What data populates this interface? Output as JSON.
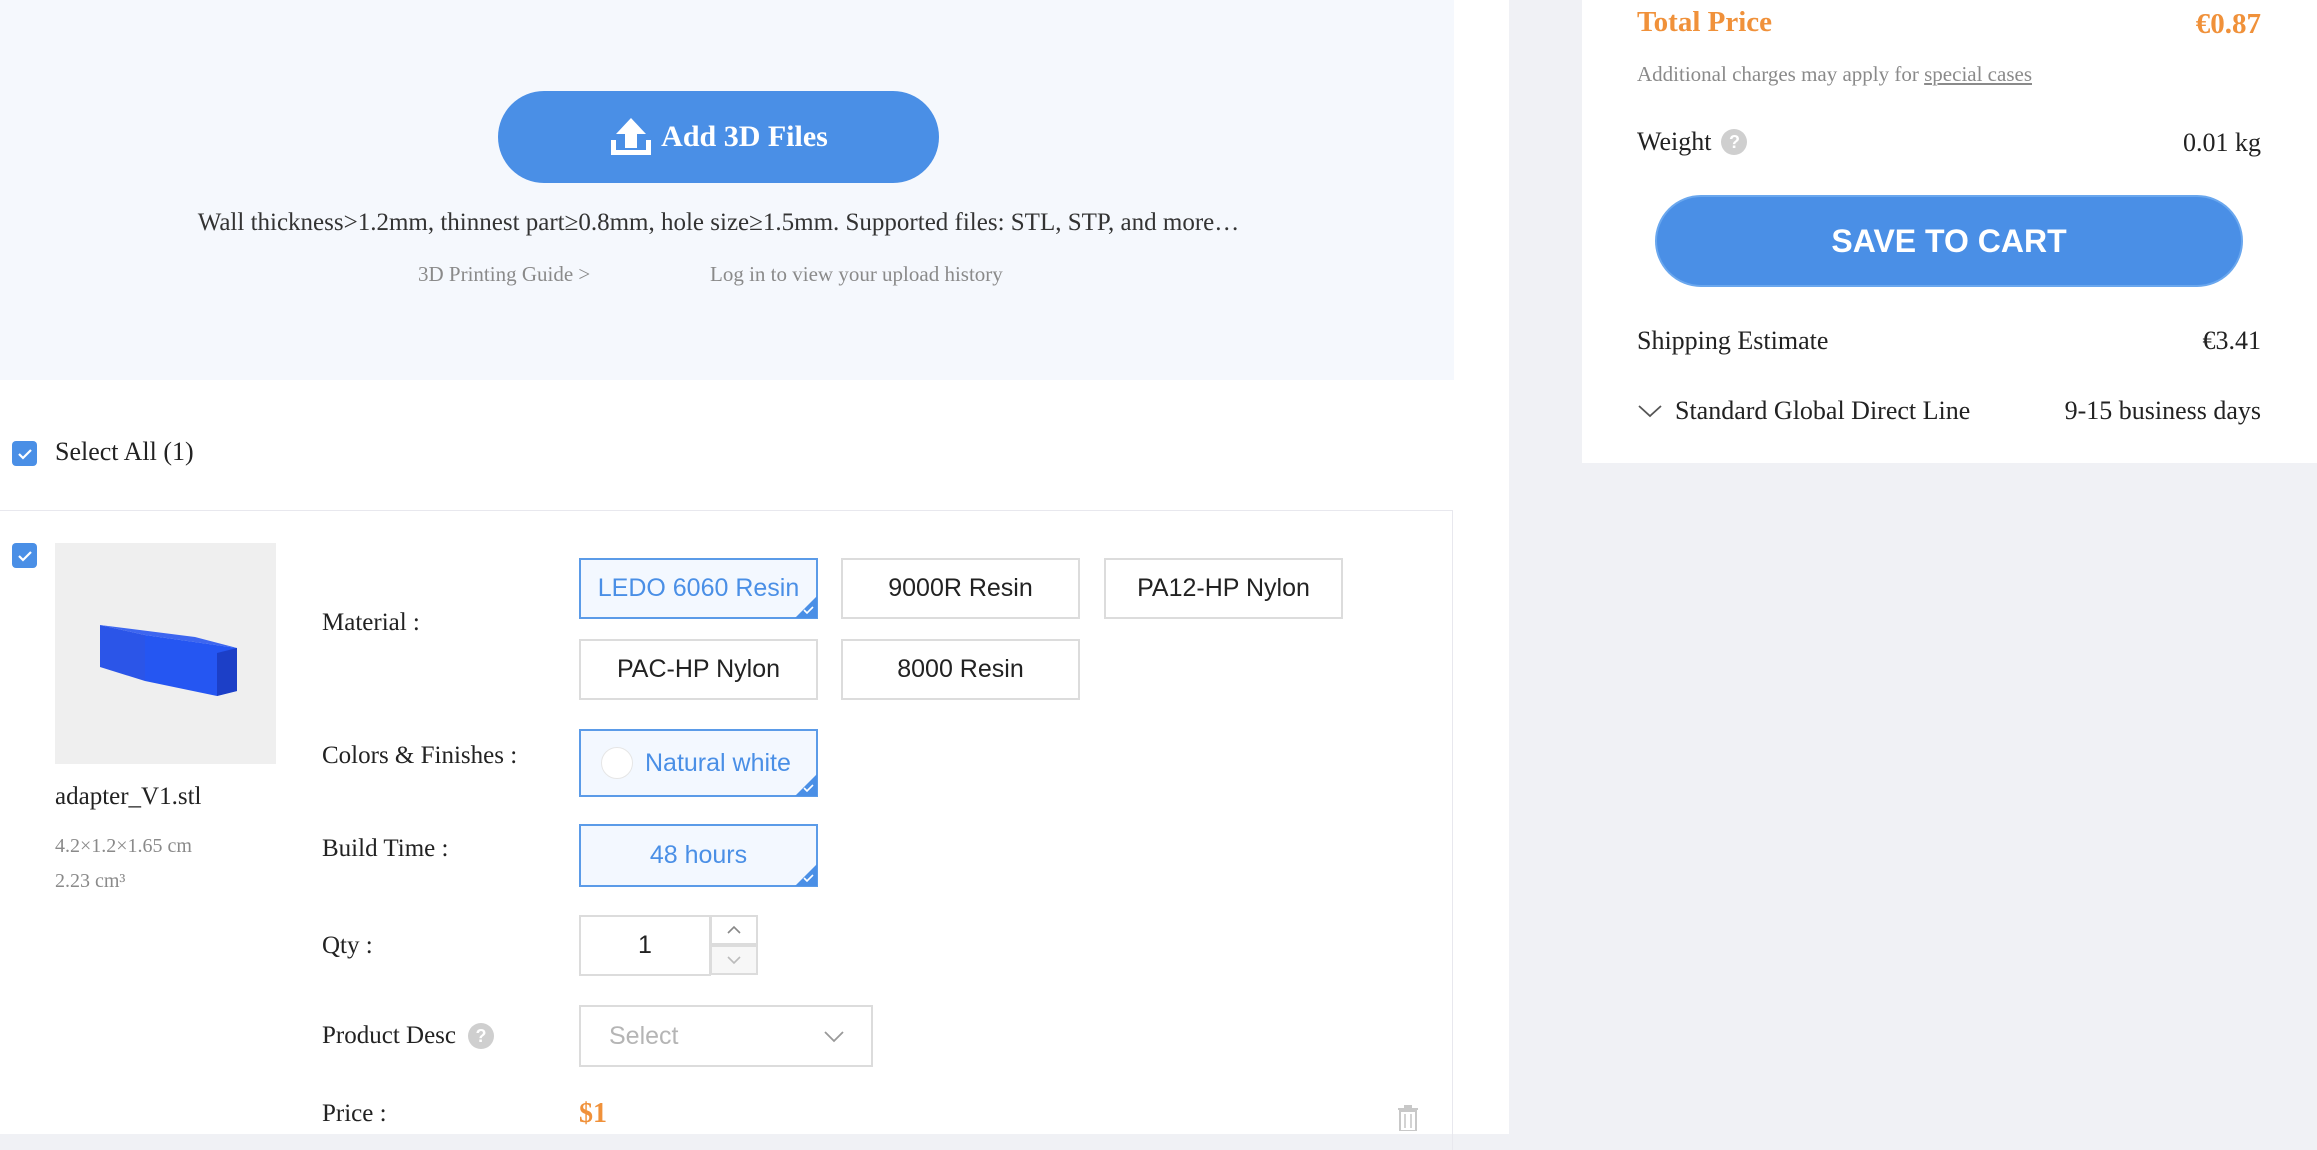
{
  "upload": {
    "button_label": "Add 3D Files",
    "requirements": "Wall thickness>1.2mm, thinnest part≥0.8mm, hole size≥1.5mm. Supported files: STL, STP, and more…",
    "guide_link": "3D Printing Guide >",
    "history_link": "Log in to view your upload history"
  },
  "selection": {
    "select_all_label": "Select All (1)"
  },
  "item": {
    "file_name": "adapter_V1.stl",
    "dimensions": "4.2×1.2×1.65 cm",
    "volume": "2.23 cm³",
    "labels": {
      "material": "Material :",
      "colors": "Colors & Finishes :",
      "build_time": "Build Time :",
      "qty": "Qty :",
      "product_desc": "Product Desc",
      "price": "Price :"
    },
    "materials": [
      "LEDO 6060 Resin",
      "9000R Resin",
      "PA12-HP Nylon",
      "PAC-HP Nylon",
      "8000 Resin"
    ],
    "selected_material": "LEDO 6060 Resin",
    "color": "Natural white",
    "build_time": "48 hours",
    "qty": "1",
    "product_desc_placeholder": "Select",
    "price": "$1"
  },
  "summary": {
    "total_label": "Total Price",
    "total_value": "€0.87",
    "charges_note_prefix": "Additional charges may apply for ",
    "charges_note_link": "special cases",
    "weight_label": "Weight",
    "weight_value": "0.01 kg",
    "save_button": "SAVE TO CART",
    "shipping_label": "Shipping Estimate",
    "shipping_value": "€3.41",
    "shipping_method": "Standard Global Direct Line",
    "shipping_days": "9-15 business days"
  },
  "colors": {
    "accent": "#4a8fe6",
    "price": "#f0913a"
  },
  "icons": [
    "upload-icon",
    "check-icon",
    "chevron-up-icon",
    "chevron-down-icon",
    "help-icon",
    "trash-icon",
    "product-thumbnail"
  ]
}
